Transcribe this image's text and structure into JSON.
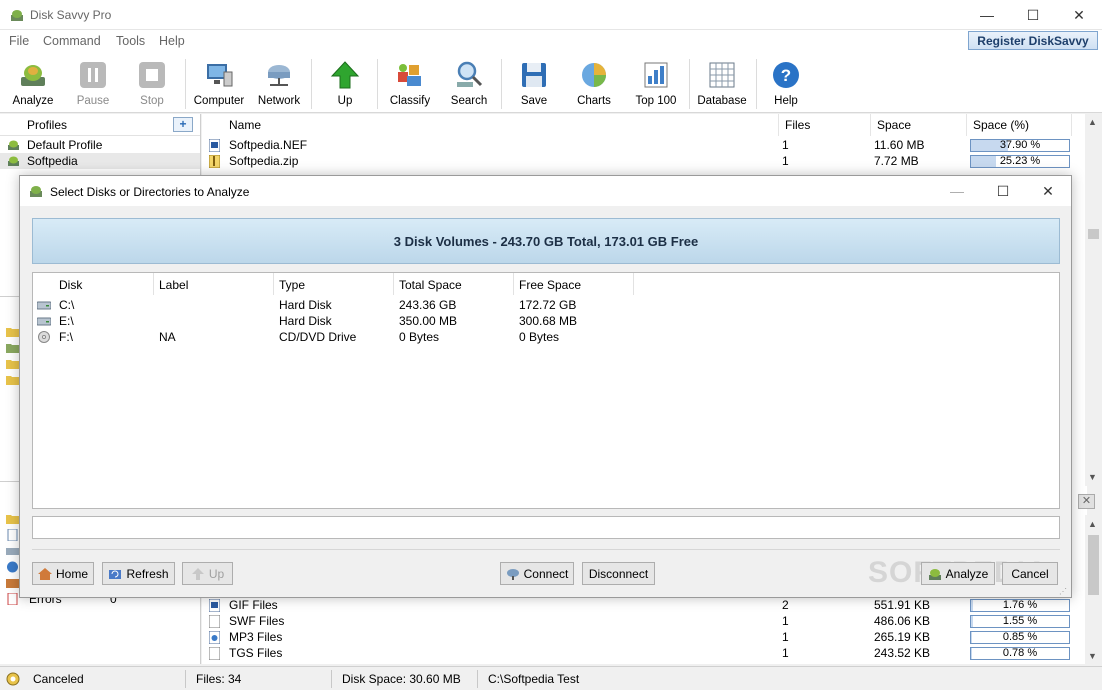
{
  "window": {
    "title": "Disk Savvy Pro",
    "controls": {
      "minimize": "—",
      "maximize": "☐",
      "close": "✕"
    }
  },
  "menu": [
    "File",
    "Command",
    "Tools",
    "Help"
  ],
  "register_button": "Register DiskSavvy",
  "toolbar": [
    {
      "label": "Analyze",
      "icon": "analyze-icon",
      "enabled": true
    },
    {
      "label": "Pause",
      "icon": "pause-icon",
      "enabled": false
    },
    {
      "label": "Stop",
      "icon": "stop-icon",
      "enabled": false
    },
    {
      "label": "Computer",
      "icon": "computer-icon",
      "enabled": true
    },
    {
      "label": "Network",
      "icon": "network-icon",
      "enabled": true
    },
    {
      "label": "Up",
      "icon": "up-arrow-icon",
      "enabled": true
    },
    {
      "label": "Classify",
      "icon": "classify-icon",
      "enabled": true
    },
    {
      "label": "Search",
      "icon": "search-icon",
      "enabled": true
    },
    {
      "label": "Save",
      "icon": "save-icon",
      "enabled": true
    },
    {
      "label": "Charts",
      "icon": "pie-chart-icon",
      "enabled": true
    },
    {
      "label": "Top 100",
      "icon": "top100-icon",
      "enabled": true
    },
    {
      "label": "Database",
      "icon": "database-icon",
      "enabled": true
    },
    {
      "label": "Help",
      "icon": "help-icon",
      "enabled": true
    }
  ],
  "profiles": {
    "header": "Profiles",
    "items": [
      "Default Profile",
      "Softpedia"
    ]
  },
  "left_lower": {
    "errors_label": "Errors",
    "errors_value": "0"
  },
  "filelist": {
    "columns": [
      "Name",
      "Files",
      "Space",
      "Space (%)"
    ],
    "top_rows": [
      {
        "name": "Softpedia.NEF",
        "files": "1",
        "space": "11.60 MB",
        "pct": "37.90 %",
        "pct_value": 37.9
      },
      {
        "name": "Softpedia.zip",
        "files": "1",
        "space": "7.72 MB",
        "pct": "25.23 %",
        "pct_value": 25.23
      }
    ],
    "bottom_rows": [
      {
        "name": "GIF Files",
        "files": "2",
        "space": "551.91 KB",
        "pct": "1.76 %",
        "pct_value": 1.76
      },
      {
        "name": "SWF Files",
        "files": "1",
        "space": "486.06 KB",
        "pct": "1.55 %",
        "pct_value": 1.55
      },
      {
        "name": "MP3 Files",
        "files": "1",
        "space": "265.19 KB",
        "pct": "0.85 %",
        "pct_value": 0.85
      },
      {
        "name": "TGS Files",
        "files": "1",
        "space": "243.52 KB",
        "pct": "0.78 %",
        "pct_value": 0.78
      }
    ]
  },
  "dialog": {
    "title": "Select Disks or Directories to Analyze",
    "summary": "3 Disk Volumes - 243.70 GB Total, 173.01 GB Free",
    "columns": [
      "Disk",
      "Label",
      "Type",
      "Total Space",
      "Free Space"
    ],
    "disks": [
      {
        "disk": "C:\\",
        "label": "",
        "type": "Hard Disk",
        "total": "243.36 GB",
        "free": "172.72 GB",
        "icon": "hard-disk-icon"
      },
      {
        "disk": "E:\\",
        "label": "",
        "type": "Hard Disk",
        "total": "350.00 MB",
        "free": "300.68 MB",
        "icon": "hard-disk-icon"
      },
      {
        "disk": "F:\\",
        "label": "NA",
        "type": "CD/DVD Drive",
        "total": "0 Bytes",
        "free": "0 Bytes",
        "icon": "cd-drive-icon"
      }
    ],
    "path_value": "",
    "buttons": {
      "home": "Home",
      "refresh": "Refresh",
      "up": "Up",
      "connect": "Connect",
      "disconnect": "Disconnect",
      "analyze": "Analyze",
      "cancel": "Cancel"
    },
    "watermark": "SOFTPEDIA"
  },
  "statusbar": {
    "status": "Canceled",
    "files": "Files: 34",
    "disk_space": "Disk Space: 30.60 MB",
    "path": "C:\\Softpedia Test"
  }
}
